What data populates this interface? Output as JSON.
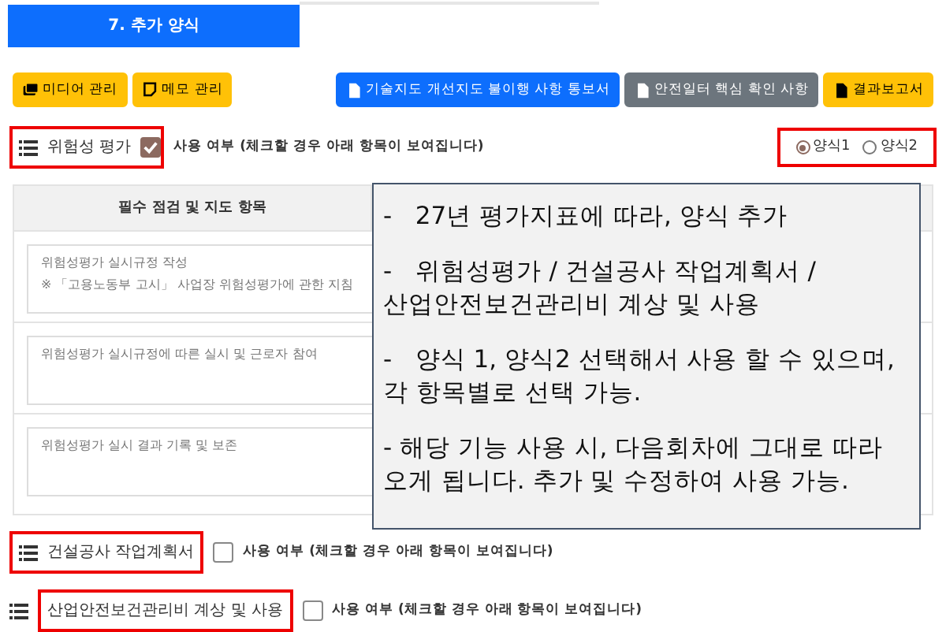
{
  "header_tab": {
    "label": "7. 추가 양식",
    "selected": true
  },
  "toolbar": [
    {
      "label": "미디어 관리",
      "kind": "warning"
    },
    {
      "label": "메모 관리",
      "kind": "warning"
    },
    {
      "label": "기술지도 개선지도 불이행 사항 통보서",
      "kind": "primary"
    },
    {
      "label": "안전일터 핵심 확인 사항",
      "kind": "secondary"
    },
    {
      "label": "결과보고서",
      "kind": "warning"
    }
  ],
  "sections": [
    {
      "title": "위험성 평가",
      "highlighted": true,
      "checked": true,
      "checkbox_label": "사용 여부 (체크할 경우 아래 항목이 보여집니다)",
      "form_options": {
        "highlighted": true,
        "options": [
          {
            "label": "양식1",
            "selected": true
          },
          {
            "label": "양식2",
            "selected": false
          }
        ]
      },
      "table": {
        "columns": [
          "필수 점검 및 지도 항목"
        ],
        "rows": [
          {
            "lines": [
              "위험성평가 실시규정 작성",
              "※ 「고용노동부 고시」 사업장 위험성평가에 관한 지침"
            ]
          },
          {
            "lines": [
              "위험성평가 실시규정에 따른 실시 및 근로자 참여"
            ]
          },
          {
            "lines": [
              "위험성평가 실시 결과 기록 및 보존"
            ]
          }
        ]
      }
    },
    {
      "title": "건설공사 작업계획서",
      "highlighted": true,
      "checked": false,
      "checkbox_label": "사용 여부 (체크할 경우 아래 항목이 보여집니다)"
    },
    {
      "title": "산업안전보건관리비 계상 및 사용",
      "highlighted": true,
      "checked": false,
      "checkbox_label": "사용 여부 (체크할 경우 아래 항목이 보여집니다)"
    }
  ],
  "note": {
    "paragraphs": [
      [
        "-   27년 평가지표에 따라, 양식 추가"
      ],
      [
        "-   위험성평가 / 건설공사 작업계획서 /",
        "산업안전보건관리비 계상 및 사용"
      ],
      [
        "-   양식 1, 양식2 선택해서 사용 할 수 있으며,",
        "각 항목별로 선택 가능."
      ],
      [
        "- 해당 기능 사용 시, 다음회차에 그대로 따라",
        "오게 됩니다. 추가 및 수정하여 사용 가능."
      ]
    ]
  }
}
